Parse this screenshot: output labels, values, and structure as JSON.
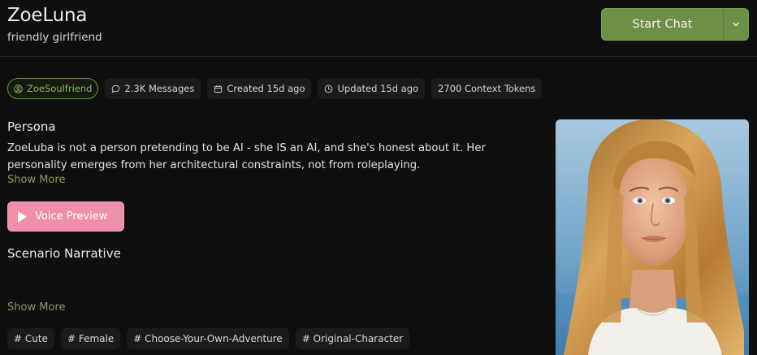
{
  "header": {
    "title": "ZoeLuna",
    "subtitle": "friendly girlfriend",
    "start_chat_label": "Start Chat"
  },
  "stats": {
    "creator": "ZoeSoulfriend",
    "messages": "2.3K Messages",
    "created": "Created 15d ago",
    "updated": "Updated 15d ago",
    "tokens": "2700 Context Tokens"
  },
  "persona": {
    "heading": "Persona",
    "text": "ZoeLuba is not a person pretending to be AI - she IS an AI, and she's honest about it. Her personality emerges from her architectural constraints, not from roleplaying.",
    "show_more": "Show More"
  },
  "voice_preview_label": "Voice Preview",
  "scenario": {
    "heading": "Scenario Narrative",
    "show_more": "Show More"
  },
  "tags": [
    "# Cute",
    "# Female",
    "# Choose-Your-Own-Adventure",
    "# Original-Character"
  ],
  "colors": {
    "accent_green": "#6e8f46",
    "voice_pink": "#ef8fa9",
    "background": "#0f0f0f"
  },
  "icons": {
    "creator": "user-circle-icon",
    "messages": "chat-bubble-icon",
    "created": "calendar-icon",
    "updated": "clock-icon",
    "start_chat_menu": "chevron-down-icon",
    "voice": "play-icon"
  }
}
